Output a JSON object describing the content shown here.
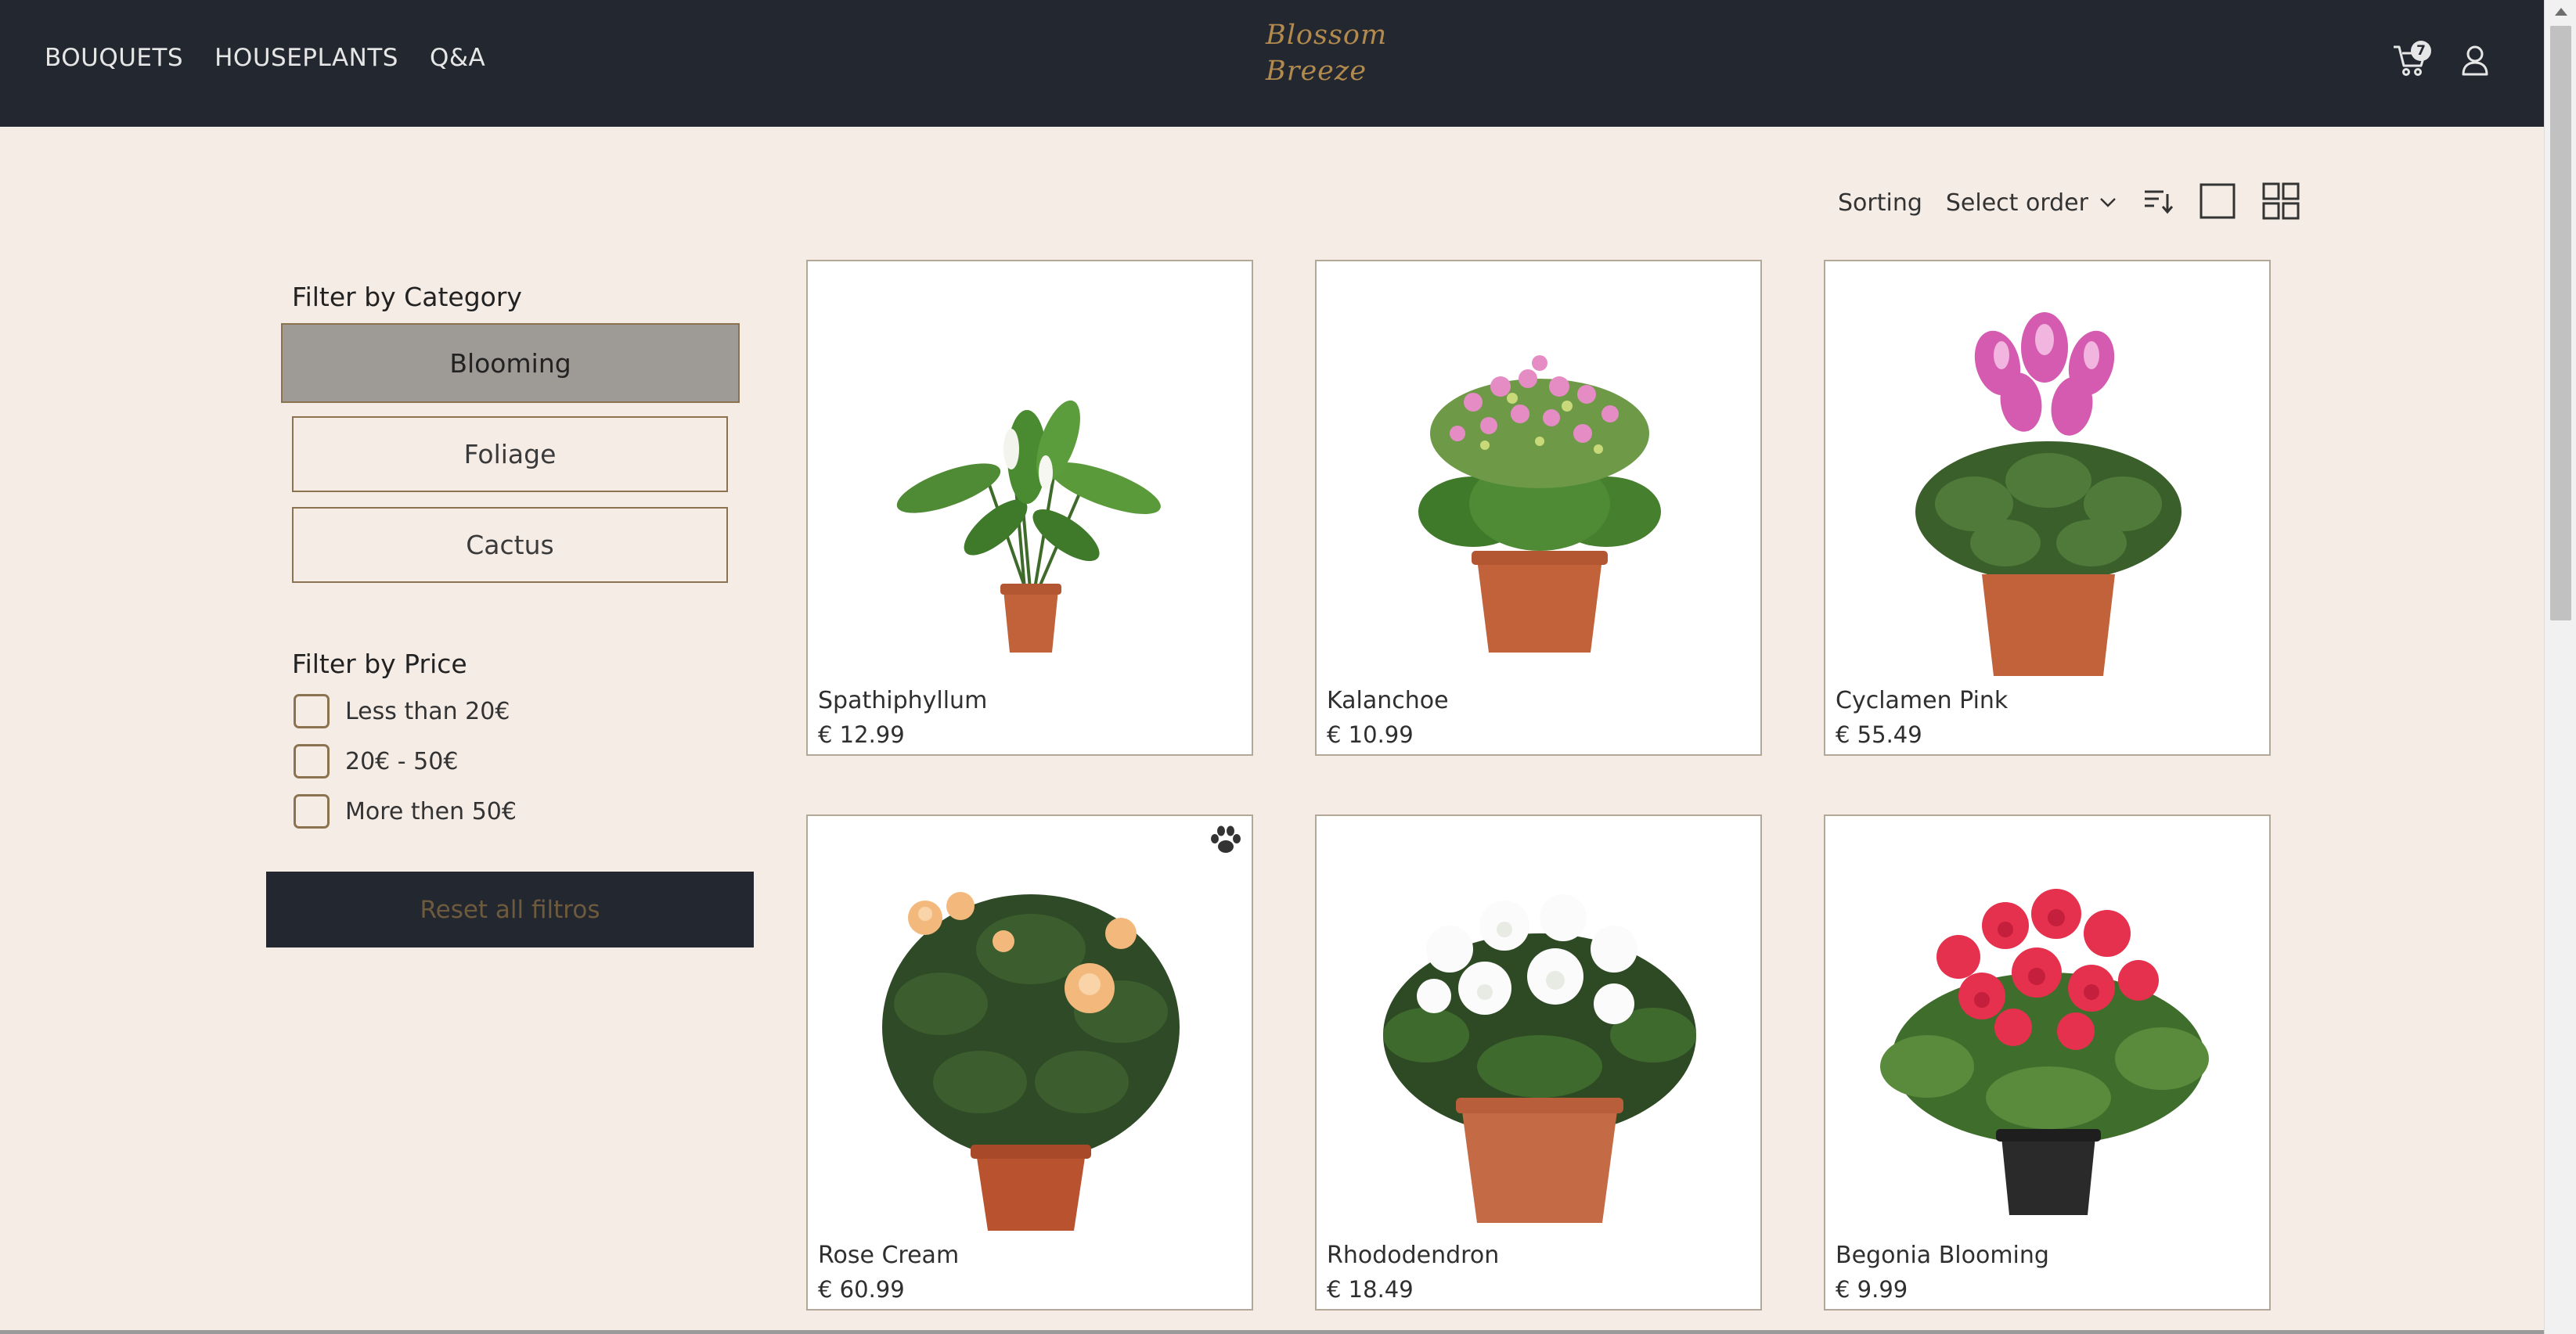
{
  "header": {
    "nav": [
      "BOUQUETS",
      "HOUSEPLANTS",
      "Q&A"
    ],
    "logo_line1": "Blossom",
    "logo_line2": "Breeze",
    "cart_count": "7",
    "cart_icon": "cart-icon",
    "user_icon": "user-icon"
  },
  "toolbar": {
    "sorting_label": "Sorting",
    "select_order": "Select order",
    "icons": [
      "chevron-down-icon",
      "sort-direction-icon",
      "single-view-icon",
      "grid-view-icon"
    ]
  },
  "sidebar": {
    "category_title": "Filter by Category",
    "categories": [
      "Blooming",
      "Foliage",
      "Cactus"
    ],
    "active_category": "Blooming",
    "price_title": "Filter by Price",
    "price_options": [
      "Less than 20€",
      "20€ - 50€",
      "More then 50€"
    ],
    "reset_label": "Reset all filtros"
  },
  "products": [
    {
      "name": "Spathiphyllum",
      "price": "€ 12.99"
    },
    {
      "name": "Kalanchoe",
      "price": "€ 10.99"
    },
    {
      "name": "Cyclamen Pink",
      "price": "€ 55.49"
    },
    {
      "name": "Rose Cream",
      "price": "€ 60.99",
      "badge_icon": "paw-icon"
    },
    {
      "name": "Rhododendron",
      "price": "€ 18.49"
    },
    {
      "name": "Begonia Blooming",
      "price": "€ 9.99"
    }
  ],
  "colors": {
    "header_bg": "#232830",
    "page_bg": "#f5ece6",
    "accent": "#b28a4e",
    "border": "#8b7350"
  }
}
